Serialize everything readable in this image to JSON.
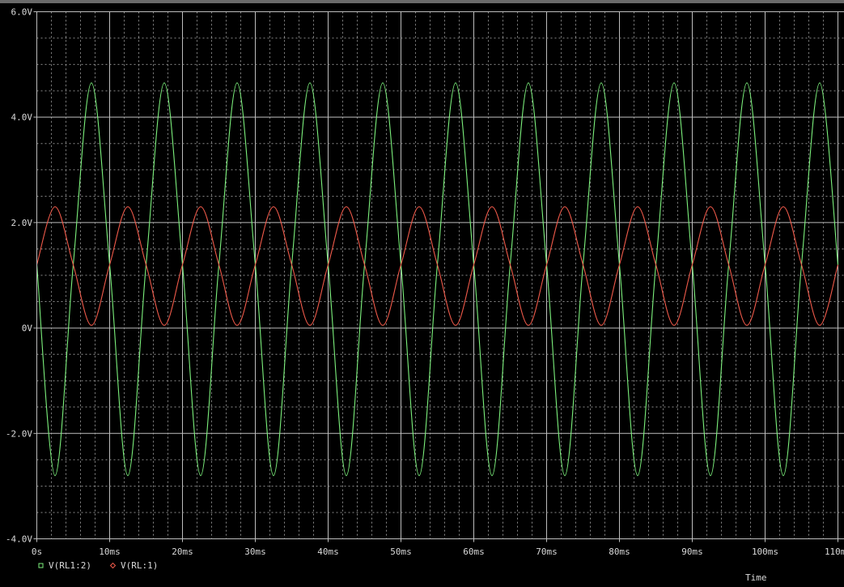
{
  "chart_data": {
    "type": "line",
    "xlabel": "Time",
    "ylabel": "",
    "x_unit": "ms",
    "xlim": [
      0,
      110
    ],
    "ylim": [
      -4.0,
      6.0
    ],
    "x_ticks": [
      {
        "value": 0,
        "label": "0s"
      },
      {
        "value": 10,
        "label": "10ms"
      },
      {
        "value": 20,
        "label": "20ms"
      },
      {
        "value": 30,
        "label": "30ms"
      },
      {
        "value": 40,
        "label": "40ms"
      },
      {
        "value": 50,
        "label": "50ms"
      },
      {
        "value": 60,
        "label": "60ms"
      },
      {
        "value": 70,
        "label": "70ms"
      },
      {
        "value": 80,
        "label": "80ms"
      },
      {
        "value": 90,
        "label": "90ms"
      },
      {
        "value": 100,
        "label": "100ms"
      },
      {
        "value": 110,
        "label": "110ms"
      }
    ],
    "y_ticks": [
      {
        "value": 6,
        "label": "6.0V"
      },
      {
        "value": 4,
        "label": "4.0V"
      },
      {
        "value": 2,
        "label": "2.0V"
      },
      {
        "value": 0,
        "label": "0V"
      },
      {
        "value": -2,
        "label": "-2.0V"
      },
      {
        "value": -4,
        "label": "-4.0V"
      }
    ],
    "grid": true,
    "legend_position": "bottom-left",
    "series": [
      {
        "name": "V(RL1:2)",
        "color": "#7cf07c",
        "marker": "square",
        "x": [
          0,
          2.5,
          5,
          7.5,
          10,
          12.5,
          15,
          17.5,
          20,
          22.5,
          25,
          27.5,
          30,
          32.5,
          35,
          37.5,
          40,
          42.5,
          45,
          47.5,
          50,
          52.5,
          55,
          57.5,
          60,
          62.5,
          65,
          67.5,
          70,
          72.5,
          75,
          77.5,
          80,
          82.5,
          85,
          87.5,
          90,
          92.5,
          95,
          97.5,
          100,
          102.5,
          105,
          107.5,
          110
        ],
        "y": [
          1.2,
          -2.8,
          1.2,
          4.65,
          1.2,
          -2.8,
          1.2,
          4.65,
          1.2,
          -2.8,
          1.2,
          4.65,
          1.2,
          -2.8,
          1.2,
          4.65,
          1.2,
          -2.8,
          1.2,
          4.65,
          1.2,
          -2.8,
          1.2,
          4.65,
          1.2,
          -2.8,
          1.2,
          4.65,
          1.2,
          -2.8,
          1.2,
          4.65,
          1.2,
          -2.8,
          1.2,
          4.65,
          1.2,
          -2.8,
          1.2,
          4.65,
          1.2,
          -2.8,
          1.2,
          4.65,
          1.2
        ]
      },
      {
        "name": "V(RL:1)",
        "color": "#f05a4a",
        "marker": "diamond",
        "x": [
          0,
          2.5,
          5,
          7.5,
          10,
          12.5,
          15,
          17.5,
          20,
          22.5,
          25,
          27.5,
          30,
          32.5,
          35,
          37.5,
          40,
          42.5,
          45,
          47.5,
          50,
          52.5,
          55,
          57.5,
          60,
          62.5,
          65,
          67.5,
          70,
          72.5,
          75,
          77.5,
          80,
          82.5,
          85,
          87.5,
          90,
          92.5,
          95,
          97.5,
          100,
          102.5,
          105,
          107.5,
          110
        ],
        "y": [
          1.2,
          2.3,
          1.2,
          0.05,
          1.2,
          2.3,
          1.2,
          0.05,
          1.2,
          2.3,
          1.2,
          0.05,
          1.2,
          2.3,
          1.2,
          0.05,
          1.2,
          2.3,
          1.2,
          0.05,
          1.2,
          2.3,
          1.2,
          0.05,
          1.2,
          2.3,
          1.2,
          0.05,
          1.2,
          2.3,
          1.2,
          0.05,
          1.2,
          2.3,
          1.2,
          0.05,
          1.2,
          2.3,
          1.2,
          0.05,
          1.2,
          2.3,
          1.2,
          0.05,
          1.2
        ]
      }
    ]
  }
}
